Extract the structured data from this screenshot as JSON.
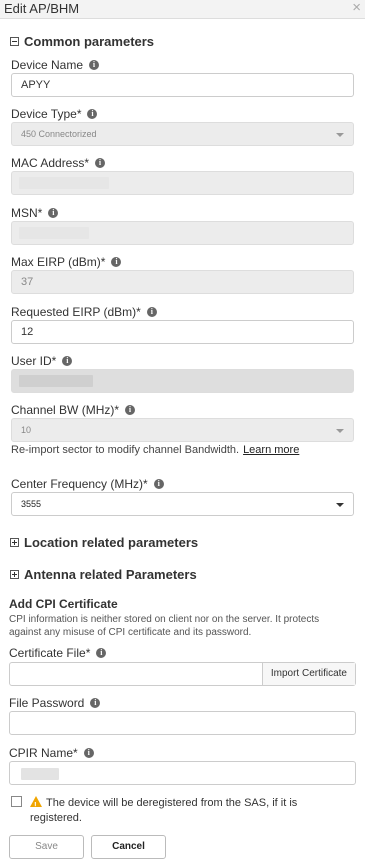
{
  "dialog": {
    "title": "Edit AP/BHM"
  },
  "common": {
    "title": "Common parameters",
    "device_name": {
      "label": "Device Name",
      "value": "APYY"
    },
    "device_type": {
      "label": "Device Type*",
      "value": "450 Connectorized"
    },
    "mac_address": {
      "label": "MAC Address*"
    },
    "msn": {
      "label": "MSN*"
    },
    "max_eirp": {
      "label": "Max EIRP (dBm)*",
      "value": "37"
    },
    "requested_eirp": {
      "label": "Requested EIRP (dBm)*",
      "value": "12"
    },
    "user_id": {
      "label": "User ID*"
    },
    "channel_bw": {
      "label": "Channel BW (MHz)*",
      "value": "10",
      "hint": "Re-import sector to modify channel Bandwidth.",
      "learn_more": "Learn more"
    },
    "center_freq": {
      "label": "Center Frequency (MHz)*",
      "value": "3555"
    }
  },
  "location": {
    "title": "Location related parameters"
  },
  "antenna": {
    "title": "Antenna related Parameters"
  },
  "cpi": {
    "title": "Add CPI Certificate",
    "description": "CPI information is neither stored on client nor on the server. It protects against any misuse of CPI certificate and its password.",
    "certificate_file": {
      "label": "Certificate File*",
      "import_label": "Import Certificate"
    },
    "file_password": {
      "label": "File Password"
    },
    "cpir_name": {
      "label": "CPIR Name*"
    }
  },
  "warning": {
    "text": "The device will be deregistered from the SAS, if it is registered."
  },
  "buttons": {
    "save": "Save",
    "cancel": "Cancel"
  },
  "colors": {
    "warning_icon": "#f0a500",
    "disabled_field": "#ececec"
  }
}
